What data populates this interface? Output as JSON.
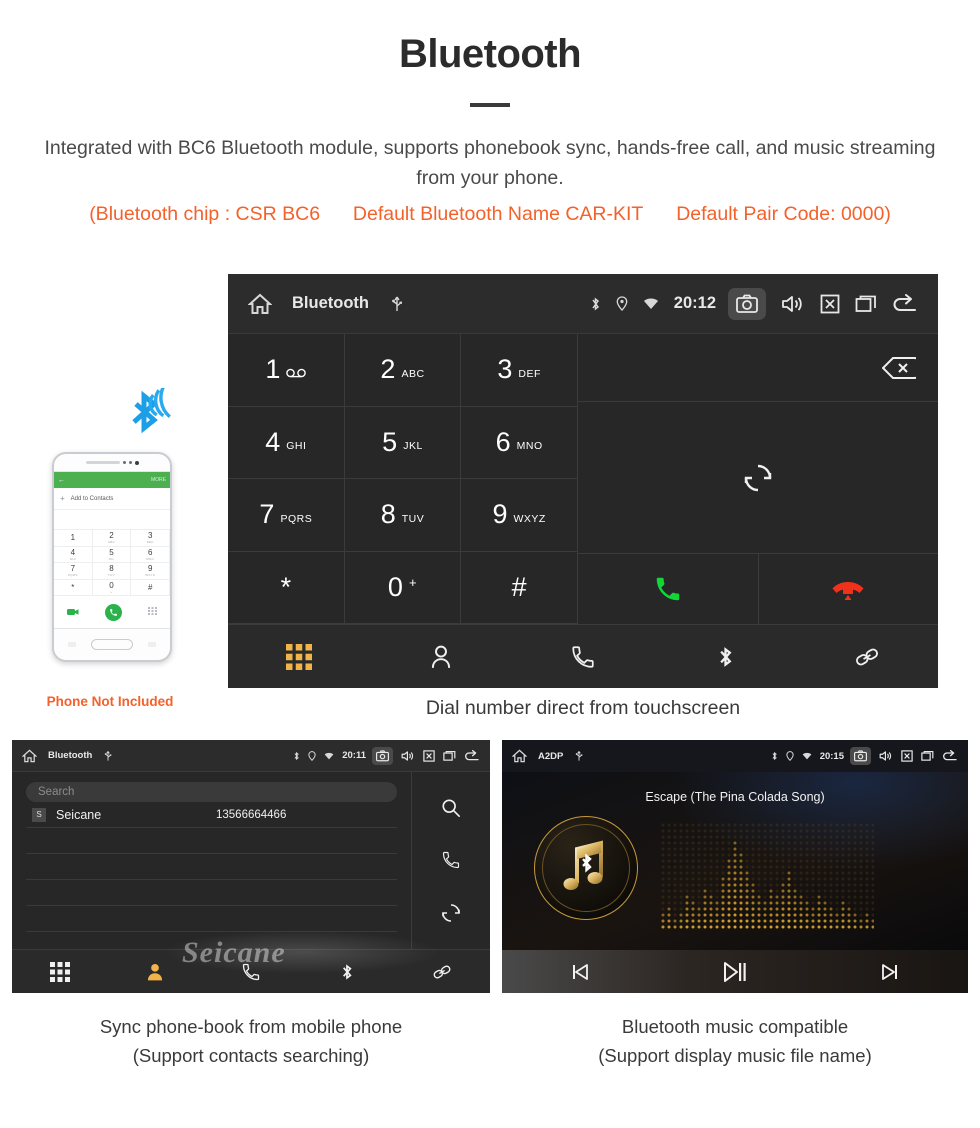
{
  "header": {
    "title": "Bluetooth",
    "description": "Integrated with BC6 Bluetooth module, supports phonebook sync, hands-free call, and music streaming from your phone.",
    "specs": [
      "(Bluetooth chip : CSR BC6",
      "Default Bluetooth Name CAR-KIT",
      "Default Pair Code: 0000)"
    ],
    "accent_color": "#f4612a",
    "text_color": "#4a4a4a"
  },
  "main_unit": {
    "statusbar": {
      "home_icon": "home-icon",
      "title": "Bluetooth",
      "usb_icon": "usb-icon",
      "bluetooth_icon": "bluetooth-icon",
      "location_icon": "location-icon",
      "wifi_icon": "wifi-icon",
      "time": "20:12",
      "camera_icon": "camera-icon",
      "volume_icon": "volume-icon",
      "close_icon": "close-box-icon",
      "recents_icon": "recents-icon",
      "back_icon": "back-arrow-icon"
    },
    "keys": [
      {
        "num": "1",
        "sub": "∞",
        "sub_kind": "voicemail"
      },
      {
        "num": "2",
        "sub": "ABC",
        "sub_kind": "letters"
      },
      {
        "num": "3",
        "sub": "DEF",
        "sub_kind": "letters"
      },
      {
        "num": "4",
        "sub": "GHI",
        "sub_kind": "letters"
      },
      {
        "num": "5",
        "sub": "JKL",
        "sub_kind": "letters"
      },
      {
        "num": "6",
        "sub": "MNO",
        "sub_kind": "letters"
      },
      {
        "num": "7",
        "sub": "PQRS",
        "sub_kind": "letters"
      },
      {
        "num": "8",
        "sub": "TUV",
        "sub_kind": "letters"
      },
      {
        "num": "9",
        "sub": "WXYZ",
        "sub_kind": "letters"
      },
      {
        "num": "*",
        "sub": "",
        "sub_kind": "none"
      },
      {
        "num": "0",
        "sub": "+",
        "sub_kind": "sup"
      },
      {
        "num": "#",
        "sub": "",
        "sub_kind": "none"
      }
    ],
    "number_value": "",
    "backspace_icon": "backspace-icon",
    "sync_icon": "sync-icon",
    "call_icon": "call-answer-icon",
    "hangup_icon": "call-end-icon",
    "nav": [
      {
        "icon": "dialpad-icon",
        "active": true
      },
      {
        "icon": "contacts-icon",
        "active": false
      },
      {
        "icon": "call-history-icon",
        "active": false
      },
      {
        "icon": "bluetooth-icon",
        "active": false
      },
      {
        "icon": "link-pair-icon",
        "active": false
      }
    ],
    "caption": "Dial number direct from touchscreen",
    "active_color": "#f0b44a"
  },
  "phone_mock": {
    "wireless_icon": "bluetooth-wireless-icon",
    "wireless_color": "#1d9fe8",
    "header_back": "←",
    "header_more": "MORE",
    "add_contact_label": "Add to Contacts",
    "keys": [
      {
        "n": "1",
        "s": ""
      },
      {
        "n": "2",
        "s": "ABC"
      },
      {
        "n": "3",
        "s": "DEF"
      },
      {
        "n": "4",
        "s": "GHI"
      },
      {
        "n": "5",
        "s": "JKL"
      },
      {
        "n": "6",
        "s": "MNO"
      },
      {
        "n": "7",
        "s": "PQRS"
      },
      {
        "n": "8",
        "s": "TUV"
      },
      {
        "n": "9",
        "s": "WXYZ"
      },
      {
        "n": "*",
        "s": ""
      },
      {
        "n": "0",
        "s": "+"
      },
      {
        "n": "#",
        "s": ""
      }
    ],
    "note": "Phone Not Included",
    "note_color": "#f4612a"
  },
  "phonebook_unit": {
    "statusbar": {
      "title": "Bluetooth",
      "time": "20:11"
    },
    "search_placeholder": "Search",
    "contacts": [
      {
        "badge": "S",
        "name": "Seicane",
        "number": "13566664466"
      }
    ],
    "empty_rows": 4,
    "rail": [
      {
        "icon": "search-icon"
      },
      {
        "icon": "call-icon"
      },
      {
        "icon": "sync-icon"
      }
    ],
    "nav": [
      {
        "icon": "dialpad-icon",
        "active": false
      },
      {
        "icon": "contacts-icon",
        "active": true
      },
      {
        "icon": "call-history-icon",
        "active": false
      },
      {
        "icon": "bluetooth-icon",
        "active": false
      },
      {
        "icon": "link-pair-icon",
        "active": false
      }
    ],
    "watermark": "Seicane",
    "caption_line1": "Sync phone-book from mobile phone",
    "caption_line2": "(Support contacts searching)"
  },
  "music_unit": {
    "statusbar": {
      "title": "A2DP",
      "time": "20:15"
    },
    "song_title": "Escape (The Pina Colada Song)",
    "album_icon": "music-note-bluetooth-icon",
    "visualizer": "dot-matrix-equalizer",
    "controls": [
      {
        "icon": "previous-track-icon"
      },
      {
        "icon": "play-pause-icon"
      },
      {
        "icon": "next-track-icon"
      }
    ],
    "caption_line1": "Bluetooth music compatible",
    "caption_line2": "(Support display music file name)",
    "accent_color": "#c79a3c"
  }
}
